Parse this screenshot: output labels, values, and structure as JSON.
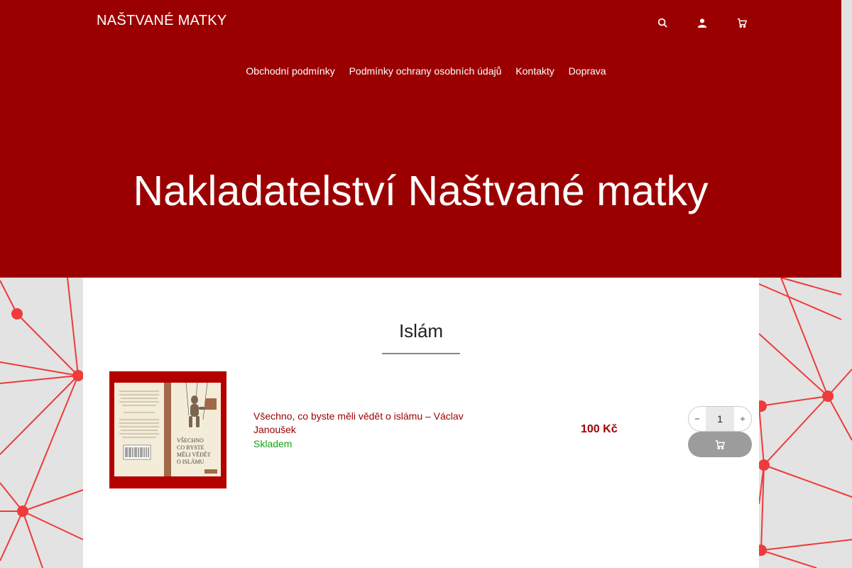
{
  "site": {
    "logo_text": "NAŠTVANÉ MATKY"
  },
  "header_icons": [
    {
      "name": "search-icon"
    },
    {
      "name": "account-icon"
    },
    {
      "name": "cart-icon"
    }
  ],
  "nav": {
    "items": [
      "Obchodní podmínky",
      "Podmínky ochrany osobních údajů",
      "Kontakty",
      "Doprava"
    ]
  },
  "hero": {
    "title": "Nakladatelství Naštvané matky"
  },
  "category": {
    "title": "Islám"
  },
  "product": {
    "name": "Všechno, co byste měli vědět o islámu – Václav Janoušek",
    "stock": "Skladem",
    "price": "100 Kč",
    "quantity": "1",
    "cover": {
      "title_lines": [
        "VŠECHNO",
        "CO BYSTE",
        "MĚLI VĚDĚT",
        "O ISLÁMU"
      ]
    }
  },
  "colors": {
    "brand": "#9b0000",
    "stock": "#16a116",
    "net": "#e83a3a"
  }
}
